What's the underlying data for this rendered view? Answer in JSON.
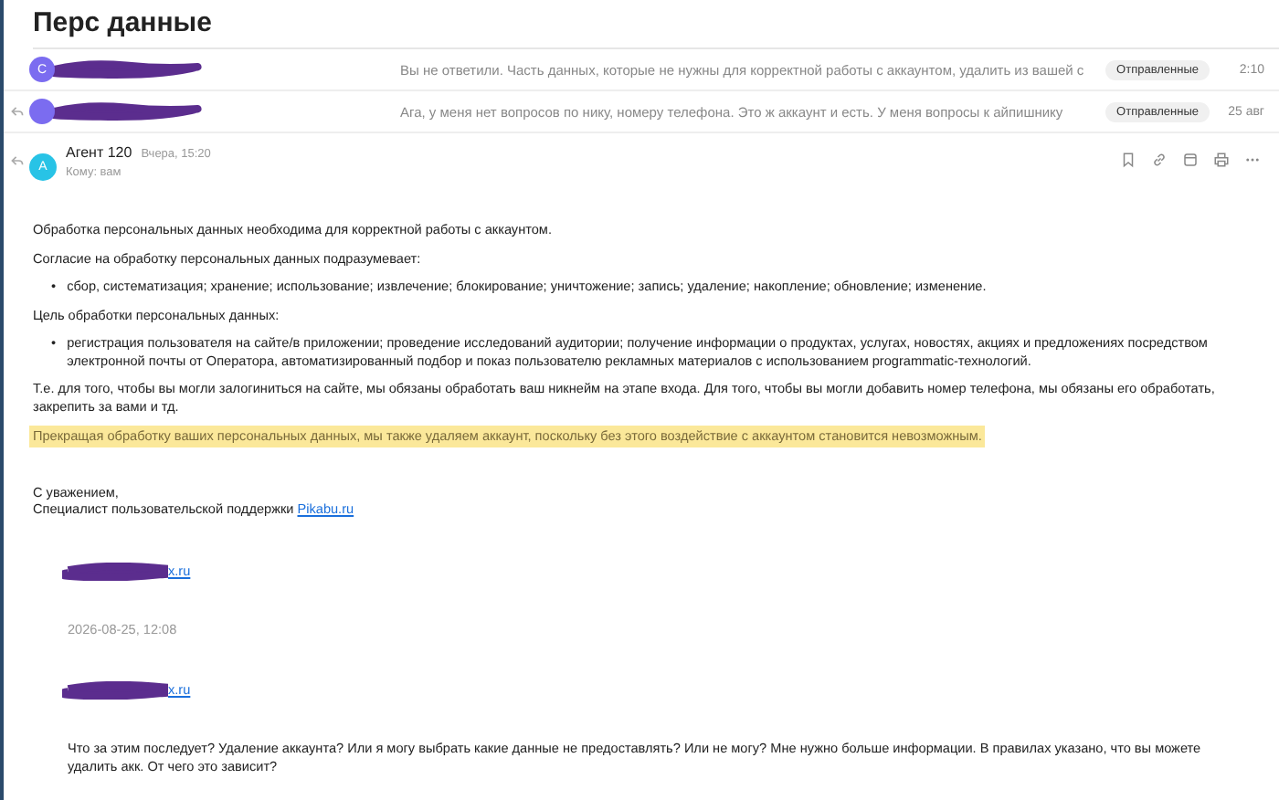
{
  "folder_title": "Перс данные",
  "threads": [
    {
      "avatar_letter": "С",
      "replied": false,
      "preview": "Вы не ответили. Часть данных, которые не нужны для корректной работы с аккаунтом, удалить из вашей с",
      "tag": "Отправленные",
      "date": "2:10"
    },
    {
      "replied": true,
      "preview": "Ага, у меня нет вопросов по нику, номеру телефона. Это ж аккаунт и есть. У меня вопросы к айпишнику",
      "tag": "Отправленные",
      "date": "25 авг"
    }
  ],
  "message": {
    "replied": true,
    "avatar_letter": "А",
    "sender": "Агент 120",
    "time": "Вчера, 15:20",
    "recipient": "Кому: вам",
    "body": [
      {
        "kind": "paragraph",
        "text": "Обработка персональных данных необходима для корректной работы с аккаунтом.",
        "highlighted": false
      },
      {
        "kind": "paragraph",
        "text": "Согласие на обработку персональных данных подразумевает:",
        "highlighted": false
      },
      {
        "kind": "bullets",
        "marker": "•",
        "items": [
          "сбор, систематизация; хранение; использование; извлечение; блокирование; уничтожение; запись; удаление; накопление; обновление; изменение."
        ]
      },
      {
        "kind": "paragraph",
        "text": "Цель обработки персональных данных:",
        "highlighted": false
      },
      {
        "kind": "bullets",
        "marker": "•",
        "items": [
          "регистрация пользователя на сайте/в приложении; проведение исследований аудитории; получение информации о продуктах, услугах, новостях, акциях и предложениях посредством электронной почты от Оператора, автоматизированный подбор и показ пользователю рекламных материалов с использованием programmatic-технологий."
        ]
      },
      {
        "kind": "paragraph",
        "text": "Т.е. для того, чтобы вы могли залогиниться на сайте, мы обязаны обработать ваш никнейм на этапе входа. Для того, чтобы вы могли добавить номер телефона, мы обязаны его обработать, закрепить за вами и тд.",
        "highlighted": false
      },
      {
        "kind": "paragraph",
        "text": "Прекращая обработку ваших персональных данных, мы также удаляем аккаунт, поскольку без этого воздействие с аккаунтом становится невозможным.",
        "highlighted": true
      },
      {
        "kind": "signature",
        "lines": [
          "С уважением,",
          "Специалист пользовательской поддержки"
        ],
        "link": "Pikabu.ru"
      },
      {
        "kind": "redacted_link",
        "text": "x.ru"
      },
      {
        "kind": "quote_date",
        "text": "2026-08-25, 12:08"
      },
      {
        "kind": "redacted_link",
        "text": "x.ru"
      },
      {
        "kind": "quote_paragraph",
        "text": "Что за этим последует? Удаление аккаунта? Или я могу выбрать какие данные не предоставлять? Или не могу? Мне нужно больше информации. В правилах указано, что вы можете удалить акк. От чего это зависит?"
      }
    ]
  }
}
